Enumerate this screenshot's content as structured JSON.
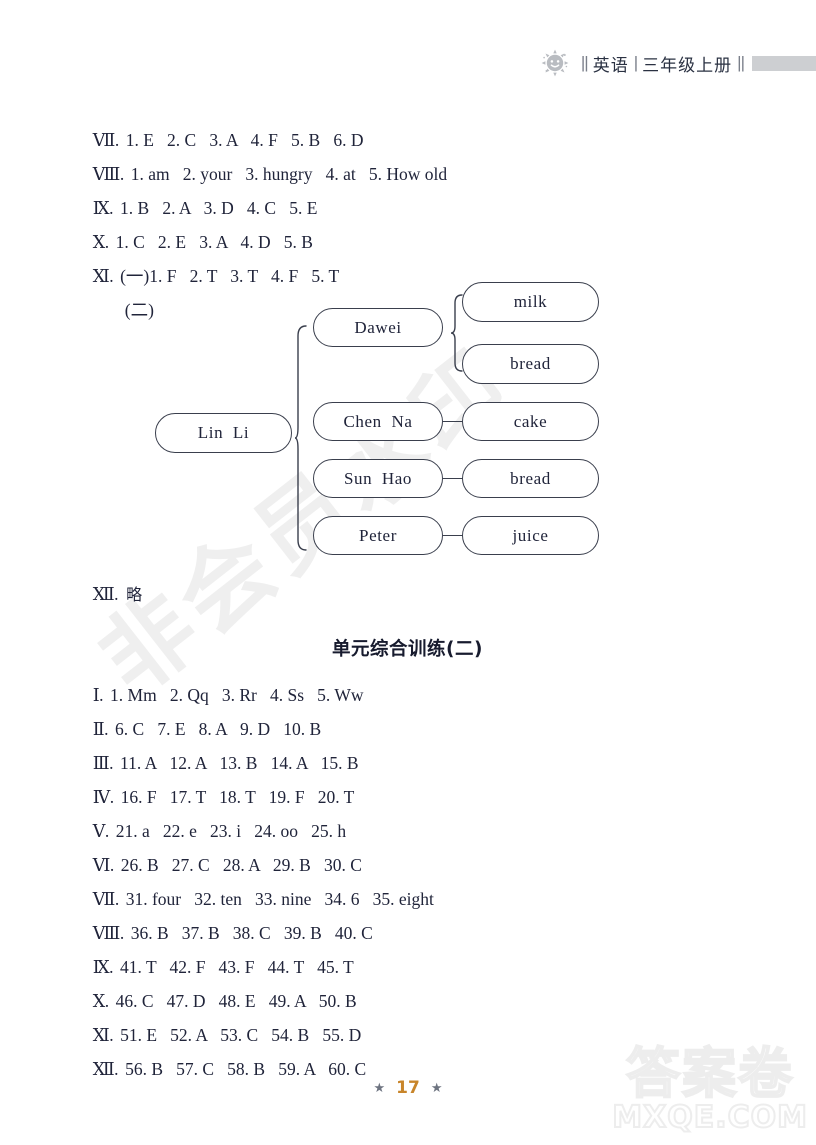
{
  "header": {
    "sun_icon": "sun-icon",
    "subject": "英语",
    "grade": "三年级上册",
    "separator": "||",
    "separator2": "|",
    "separator3": "||"
  },
  "answers_top": [
    {
      "numeral": "Ⅶ.",
      "text": "1. E   2. C   3. A   4. F   5. B   6. D"
    },
    {
      "numeral": "Ⅷ.",
      "text": "1. am   2. your   3. hungry   4. at   5. How old"
    },
    {
      "numeral": "Ⅸ.",
      "text": "1. B   2. A   3. D   4. C   5. E"
    },
    {
      "numeral": "Ⅹ.",
      "text": "1. C   2. E   3. A   4. D   5. B"
    },
    {
      "numeral": "Ⅺ.",
      "text": "(一)1. F   2. T   3. T   4. F   5. T"
    },
    {
      "numeral": "",
      "text": "(二)"
    }
  ],
  "diagram": {
    "root": {
      "label": "Lin  Li"
    },
    "people": [
      {
        "label": "Dawei"
      },
      {
        "label": "Chen  Na"
      },
      {
        "label": "Sun  Hao"
      },
      {
        "label": "Peter"
      }
    ],
    "foods": [
      {
        "label": "milk"
      },
      {
        "label": "bread"
      },
      {
        "label": "cake"
      },
      {
        "label": "bread"
      },
      {
        "label": "juice"
      }
    ]
  },
  "answer_xii": {
    "numeral": "Ⅻ.",
    "text": "略"
  },
  "section_title": "单元综合训练(二)",
  "answers_bottom": [
    {
      "numeral": "Ⅰ.",
      "text": "1. Mm   2. Qq   3. Rr   4. Ss   5. Ww"
    },
    {
      "numeral": "Ⅱ.",
      "text": "6. C   7. E   8. A   9. D   10. B"
    },
    {
      "numeral": "Ⅲ.",
      "text": "11. A   12. A   13. B   14. A   15. B"
    },
    {
      "numeral": "Ⅳ.",
      "text": "16. F   17. T   18. T   19. F   20. T"
    },
    {
      "numeral": "Ⅴ.",
      "text": "21. a   22. e   23. i   24. oo   25. h"
    },
    {
      "numeral": "Ⅵ.",
      "text": "26. B   27. C   28. A   29. B   30. C"
    },
    {
      "numeral": "Ⅶ.",
      "text": "31. four   32. ten   33. nine   34. 6   35. eight"
    },
    {
      "numeral": "Ⅷ.",
      "text": "36. B   37. B   38. C   39. B   40. C"
    },
    {
      "numeral": "Ⅸ.",
      "text": "41. T   42. F   43. F   44. T   45. T"
    },
    {
      "numeral": "Ⅹ.",
      "text": "46. C   47. D   48. E   49. A   50. B"
    },
    {
      "numeral": "Ⅺ.",
      "text": "51. E   52. A   53. C   54. B   55. D"
    },
    {
      "numeral": "Ⅻ.",
      "text": "56. B   57. C   58. B   59. A   60. C"
    }
  ],
  "footer": {
    "page_number": "17",
    "star_left": "★",
    "star_right": "★"
  },
  "watermarks": {
    "diagonal": "非会员水印",
    "corner_cn": "答案卷",
    "corner_en": "MXQE.COM"
  },
  "colors": {
    "text": "#20243a",
    "page_number": "#c8852a",
    "header_bar": "#cdcfd2",
    "node_border": "#3a3f4d",
    "watermark": "#efefef"
  }
}
